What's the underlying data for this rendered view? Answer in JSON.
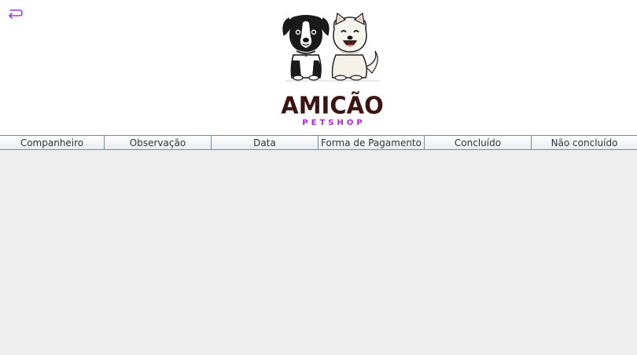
{
  "header": {
    "back_icon": "return-arrow-icon",
    "logo": {
      "title": "AMICÃO",
      "subtitle": "PETSHOP",
      "title_color": "#3a1512",
      "subtitle_color": "#b321d6"
    }
  },
  "table": {
    "columns": [
      "Companheiro",
      "Observação",
      "Data",
      "Forma de Pagamento",
      "Concluído",
      "Não concluído"
    ],
    "rows": []
  },
  "colors": {
    "accent": "#9b3de0",
    "background": "#eeeeee"
  }
}
